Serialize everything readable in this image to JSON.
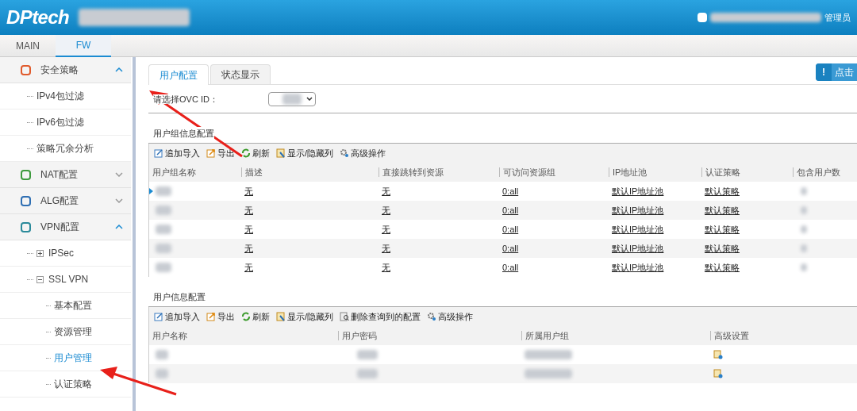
{
  "header": {
    "logo": "DPtech",
    "user_role": "管理员"
  },
  "top_tabs": [
    {
      "label": "MAIN",
      "selected": false
    },
    {
      "label": "FW",
      "selected": true
    }
  ],
  "sidebar": {
    "items": [
      {
        "label": "安全策略",
        "expanded": true,
        "children": [
          {
            "label": "IPv4包过滤",
            "selected": false
          },
          {
            "label": "IPv6包过滤",
            "selected": false
          },
          {
            "label": "策略冗余分析",
            "selected": false
          }
        ]
      },
      {
        "label": "NAT配置",
        "expanded": false
      },
      {
        "label": "ALG配置",
        "expanded": false
      },
      {
        "label": "VPN配置",
        "expanded": true,
        "children": [
          {
            "label": "IPSec",
            "expanded": false
          },
          {
            "label": "SSL VPN",
            "expanded": true,
            "children": [
              {
                "label": "基本配置",
                "selected": false
              },
              {
                "label": "资源管理",
                "selected": false
              },
              {
                "label": "用户管理",
                "selected": true
              },
              {
                "label": "认证策略",
                "selected": false
              }
            ]
          }
        ]
      }
    ]
  },
  "content_tabs": [
    {
      "label": "用户配置",
      "selected": true
    },
    {
      "label": "状态显示",
      "selected": false
    }
  ],
  "hint_button": {
    "icon": "!",
    "label": "点击"
  },
  "ovc_field": {
    "label": "请选择OVC ID："
  },
  "group_section": {
    "title": "用户组信息配置",
    "toolbar": [
      {
        "kind": "import",
        "label": "追加导入"
      },
      {
        "kind": "export",
        "label": "导出"
      },
      {
        "kind": "refresh",
        "label": "刷新"
      },
      {
        "kind": "columns",
        "label": "显示/隐藏列"
      },
      {
        "kind": "advanced",
        "label": "高级操作"
      }
    ],
    "columns": [
      "用户组名称",
      "描述",
      "直接跳转到资源",
      "可访问资源组",
      "IP地址池",
      "认证策略",
      "包含用户数"
    ],
    "rows": [
      {
        "selected": true,
        "description": "无",
        "jump": "无",
        "resource_group": "0:all",
        "ip_pool": "默认IP地址池",
        "auth_policy": "默认策略"
      },
      {
        "selected": false,
        "description": "无",
        "jump": "无",
        "resource_group": "0:all",
        "ip_pool": "默认IP地址池",
        "auth_policy": "默认策略"
      },
      {
        "selected": false,
        "description": "无",
        "jump": "无",
        "resource_group": "0:all",
        "ip_pool": "默认IP地址池",
        "auth_policy": "默认策略"
      },
      {
        "selected": false,
        "description": "无",
        "jump": "无",
        "resource_group": "0:all",
        "ip_pool": "默认IP地址池",
        "auth_policy": "默认策略"
      },
      {
        "selected": false,
        "description": "无",
        "jump": "无",
        "resource_group": "0:all",
        "ip_pool": "默认IP地址池",
        "auth_policy": "默认策略"
      }
    ]
  },
  "user_section": {
    "title": "用户信息配置",
    "toolbar": [
      {
        "kind": "import",
        "label": "追加导入"
      },
      {
        "kind": "export",
        "label": "导出"
      },
      {
        "kind": "refresh",
        "label": "刷新"
      },
      {
        "kind": "columns",
        "label": "显示/隐藏列"
      },
      {
        "kind": "delete",
        "label": "删除查询到的配置"
      },
      {
        "kind": "advanced",
        "label": "高级操作"
      }
    ],
    "columns": [
      "用户名称",
      "用户密码",
      "所属用户组",
      "高级设置"
    ]
  }
}
